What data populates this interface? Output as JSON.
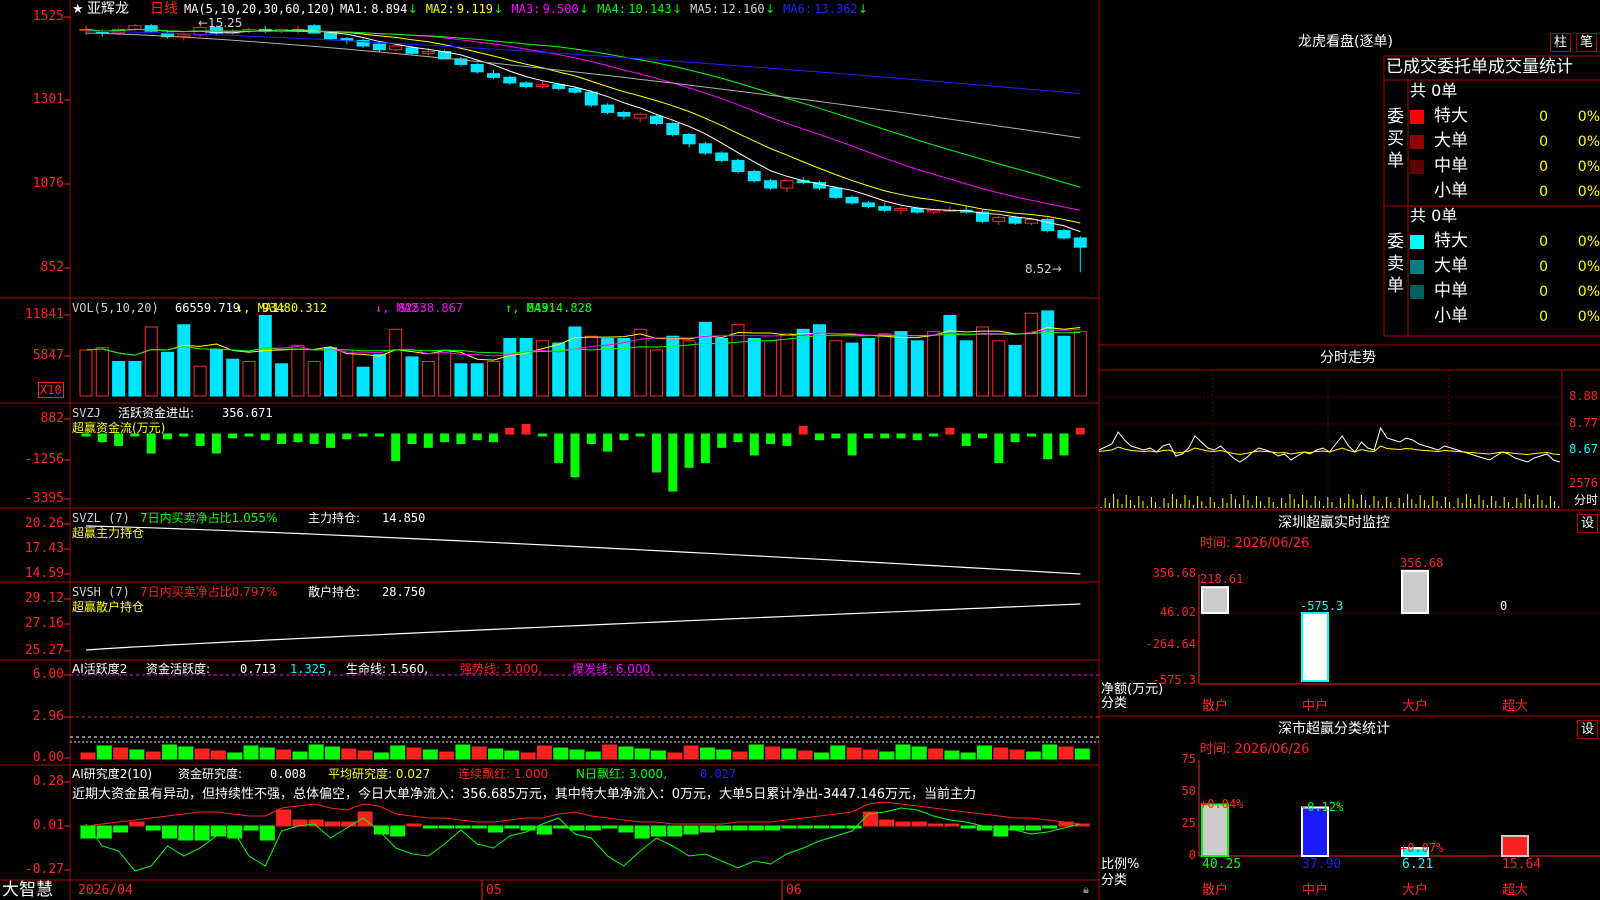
{
  "colors": {
    "up": "#ff2a2a",
    "down": "#00e5ff",
    "vol_up": "#ff2a2a",
    "vol_down": "#00e5ff",
    "frame": "#b00000",
    "bg": "#000000",
    "green": "#00ff00",
    "yellow": "#ffff00",
    "magenta": "#ff00ff",
    "white": "#ffffff",
    "gray": "#b0b0b0",
    "blue": "#2020ff",
    "red": "#ff2020"
  },
  "app": {
    "logo": "大智慧",
    "lock_icon": "lock-icon"
  },
  "stock": {
    "star": "★",
    "name": "亚辉龙",
    "period": "日线"
  },
  "kline": {
    "ma_params": "MA(5,10,20,30,60,120)",
    "ma": [
      {
        "label": "MA1:",
        "value": "8.894",
        "arrow": "↓",
        "color": "#ffffff"
      },
      {
        "label": "MA2:",
        "value": "9.119",
        "arrow": "↓",
        "color": "#ffff00"
      },
      {
        "label": "MA3:",
        "value": "9.500",
        "arrow": "↓",
        "color": "#ff00ff"
      },
      {
        "label": "MA4:",
        "value": "10.143",
        "arrow": "↓",
        "color": "#00ff00"
      },
      {
        "label": "MA5:",
        "value": "12.160",
        "arrow": "↓",
        "color": "#d0d0d0"
      },
      {
        "label": "MA6:",
        "value": "13.362",
        "arrow": "↓",
        "color": "#2020ff"
      }
    ],
    "yticks": [
      "1525",
      "1301",
      "1076",
      "852"
    ],
    "high_mark": "←15.25",
    "low_mark": "8.52→"
  },
  "chart_data": {
    "type": "candlestick",
    "title": "亚辉龙 日线",
    "x_labels": [
      "2026/04",
      "05",
      "06"
    ],
    "candles": [
      [
        15.1,
        15.2,
        14.95,
        15.1
      ],
      [
        15.05,
        15.1,
        14.9,
        15.0
      ],
      [
        15.0,
        15.15,
        14.95,
        15.1
      ],
      [
        15.1,
        15.25,
        15.05,
        15.2
      ],
      [
        15.2,
        15.25,
        15.0,
        15.05
      ],
      [
        15.0,
        15.05,
        14.85,
        14.9
      ],
      [
        14.9,
        15.0,
        14.8,
        14.95
      ],
      [
        14.95,
        15.2,
        14.9,
        15.15
      ],
      [
        15.15,
        15.2,
        14.95,
        15.0
      ],
      [
        15.0,
        15.1,
        14.95,
        15.05
      ],
      [
        15.05,
        15.15,
        15.0,
        15.1
      ],
      [
        15.1,
        15.2,
        15.0,
        15.05
      ],
      [
        15.05,
        15.1,
        15.0,
        15.1
      ],
      [
        15.1,
        15.2,
        15.0,
        15.1
      ],
      [
        15.2,
        15.25,
        15.0,
        15.0
      ],
      [
        15.0,
        15.05,
        14.8,
        14.85
      ],
      [
        14.85,
        14.9,
        14.7,
        14.8
      ],
      [
        14.8,
        14.85,
        14.6,
        14.65
      ],
      [
        14.7,
        14.75,
        14.5,
        14.55
      ],
      [
        14.55,
        14.7,
        14.5,
        14.65
      ],
      [
        14.6,
        14.65,
        14.4,
        14.45
      ],
      [
        14.45,
        14.6,
        14.4,
        14.5
      ],
      [
        14.5,
        14.55,
        14.3,
        14.3
      ],
      [
        14.3,
        14.35,
        14.1,
        14.15
      ],
      [
        14.15,
        14.2,
        13.9,
        13.95
      ],
      [
        13.9,
        14.0,
        13.75,
        13.8
      ],
      [
        13.8,
        13.85,
        13.6,
        13.65
      ],
      [
        13.65,
        13.7,
        13.5,
        13.55
      ],
      [
        13.55,
        13.7,
        13.5,
        13.6
      ],
      [
        13.6,
        13.65,
        13.45,
        13.5
      ],
      [
        13.5,
        13.55,
        13.35,
        13.4
      ],
      [
        13.4,
        13.45,
        13.0,
        13.05
      ],
      [
        13.05,
        13.1,
        12.8,
        12.85
      ],
      [
        12.85,
        12.9,
        12.65,
        12.75
      ],
      [
        12.7,
        12.85,
        12.6,
        12.8
      ],
      [
        12.75,
        12.8,
        12.5,
        12.55
      ],
      [
        12.55,
        12.6,
        12.2,
        12.25
      ],
      [
        12.25,
        12.3,
        11.9,
        12.0
      ],
      [
        12.0,
        12.05,
        11.7,
        11.75
      ],
      [
        11.75,
        11.8,
        11.5,
        11.55
      ],
      [
        11.55,
        11.6,
        11.2,
        11.25
      ],
      [
        11.25,
        11.3,
        10.95,
        11.0
      ],
      [
        11.0,
        11.05,
        10.75,
        10.8
      ],
      [
        10.8,
        11.05,
        10.7,
        11.0
      ],
      [
        11.0,
        11.1,
        10.9,
        10.95
      ],
      [
        10.95,
        11.0,
        10.75,
        10.8
      ],
      [
        10.8,
        10.85,
        10.5,
        10.55
      ],
      [
        10.55,
        10.6,
        10.35,
        10.4
      ],
      [
        10.4,
        10.45,
        10.25,
        10.3
      ],
      [
        10.3,
        10.4,
        10.15,
        10.2
      ],
      [
        10.2,
        10.3,
        10.1,
        10.25
      ],
      [
        10.25,
        10.3,
        10.1,
        10.15
      ],
      [
        10.15,
        10.25,
        10.1,
        10.2
      ],
      [
        10.2,
        10.3,
        10.15,
        10.2
      ],
      [
        10.2,
        10.3,
        10.1,
        10.15
      ],
      [
        10.15,
        10.2,
        9.85,
        9.9
      ],
      [
        9.9,
        10.05,
        9.8,
        10.0
      ],
      [
        10.0,
        10.05,
        9.8,
        9.85
      ],
      [
        9.85,
        10.0,
        9.8,
        9.95
      ],
      [
        9.95,
        10.0,
        9.6,
        9.65
      ],
      [
        9.65,
        9.7,
        9.4,
        9.45
      ],
      [
        9.45,
        9.5,
        8.52,
        9.2
      ]
    ],
    "volume": {
      "params": "VOL(5,10,20)",
      "value": "66559.719",
      "ma1": "93480.312",
      "ma2": "82538.867",
      "ma3": "84914.828",
      "yticks": [
        "11841",
        "5847"
      ],
      "unit": "X10"
    },
    "svzj": {
      "name": "SVZJ",
      "label": "活跃资金进出:",
      "value": "356.671",
      "sub": "超赢资金流(万元)",
      "yticks": [
        "882",
        "-1256",
        "-3395"
      ]
    },
    "svzl": {
      "name": "SVZL (7)",
      "note": "7日内买卖净占比1.055%",
      "label": "主力持仓:",
      "value": "14.850",
      "sub": "超赢主力持仓",
      "yticks": [
        "20.26",
        "17.43",
        "14.59"
      ]
    },
    "svsh": {
      "name": "SVSH (7)",
      "note": "7日内买卖净占比0.797%",
      "label": "散户持仓:",
      "value": "28.750",
      "sub": "超赢散户持仓",
      "yticks": [
        "29.12",
        "27.16",
        "25.27"
      ]
    },
    "ai_active": {
      "name": "AI活跃度2",
      "label": "资金活跃度:",
      "value": "0.713",
      "v2": "1.325,",
      "life": "生命线: 1.560,",
      "strong": "强势线: 3.000,",
      "burst": "爆发线: 6.000,",
      "yticks": [
        "6.00",
        "2.96",
        "0.00"
      ]
    },
    "ai_research": {
      "name": "AI研究度2(10)",
      "label": "资金研究度:",
      "value": "0.008",
      "avg": "平均研究度: 0.027",
      "cont": "连续飘红: 1.000",
      "n": "N日飘红: 3.000,",
      "last": "0.027",
      "yticks": [
        "0.28",
        "0.01",
        "-0.27"
      ],
      "comment": "近期大资金虽有异动，但持续性不强，总体偏空，今日大单净流入：356.685万元，其中特大单净流入：0万元，大单5日累计净出-3447.146万元，当前主力"
    }
  },
  "right": {
    "dragon_title": "龙虎看盘(逐单)",
    "btn_bar": "柱",
    "btn_pen": "笔",
    "stats_title": "已成交委托单成交量统计",
    "buy": {
      "side": "委买单",
      "total": "共 0单",
      "rows": [
        {
          "label": "特大",
          "n": "0",
          "p": "0%",
          "color": "#ff0000"
        },
        {
          "label": "大单",
          "n": "0",
          "p": "0%",
          "color": "#8b0000"
        },
        {
          "label": "中单",
          "n": "0",
          "p": "0%",
          "color": "#600000"
        },
        {
          "label": "小单",
          "n": "0",
          "p": "0%",
          "color": ""
        }
      ]
    },
    "sell": {
      "side": "委卖单",
      "total": "共 0单",
      "rows": [
        {
          "label": "特大",
          "n": "0",
          "p": "0%",
          "color": "#00ffff"
        },
        {
          "label": "大单",
          "n": "0",
          "p": "0%",
          "color": "#008080"
        },
        {
          "label": "中单",
          "n": "0",
          "p": "0%",
          "color": "#006060"
        },
        {
          "label": "小单",
          "n": "0",
          "p": "0%",
          "color": ""
        }
      ]
    },
    "intraday": {
      "title": "分时走势",
      "yticks": [
        "8.88",
        "8.77",
        "8.67",
        "2576"
      ],
      "unit": "分时"
    },
    "monitor": {
      "title": "深圳超赢实时监控",
      "set": "设",
      "time": "时间: 2026/06/26",
      "yticks": [
        "356.68",
        "46.02",
        "-264.64",
        "-575.3"
      ],
      "ylabel": "净额(万元)",
      "xlabel": "分类",
      "cats": [
        "散户",
        "中户",
        "大户",
        "超大"
      ],
      "values": [
        "218.61",
        "-575.3",
        "356.68",
        "0"
      ]
    },
    "classify": {
      "title": "深市超赢分类统计",
      "set": "设",
      "time": "时间: 2026/06/26",
      "yticks": [
        "75",
        "50",
        "25",
        "0"
      ],
      "ylabel": "比例%",
      "xlabel": "分类",
      "cats": [
        "散户",
        "中户",
        "大户",
        "超大"
      ],
      "pct": [
        "+0.04%",
        "-0.12%",
        "+0.07%",
        ""
      ],
      "values": [
        "40.25",
        "37.90",
        "6.21",
        "15.64"
      ]
    }
  }
}
